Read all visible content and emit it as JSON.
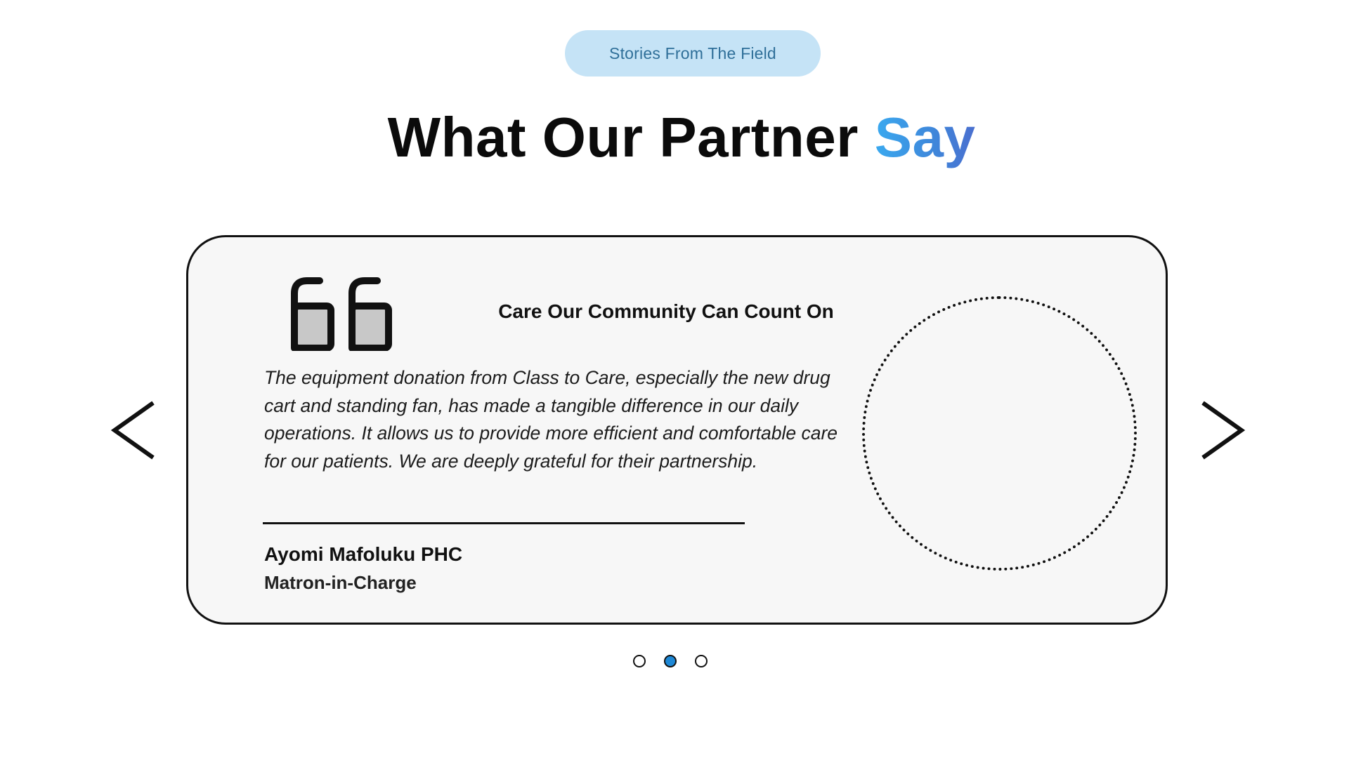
{
  "badge": {
    "label": "Stories From The Field",
    "background": "#c5e3f6",
    "text_color": "#2f6f99"
  },
  "heading": {
    "main": "What Our Partner ",
    "accent": "Say",
    "accent_colors": [
      "#3aa9ef",
      "#4a6fcf"
    ]
  },
  "testimonial": {
    "icon": "quote-icon",
    "title": "Care Our Community Can Count On",
    "quote": "The equipment donation from Class to Care, especially the new drug cart and standing fan, has made a tangible difference in our daily operations. It allows us to provide more efficient and comfortable care for our patients. We are deeply grateful for their partnership.",
    "author_name": "Ayomi Mafoluku PHC",
    "author_role": "Matron-in-Charge",
    "photo_placeholder": "dotted-circle"
  },
  "navigation": {
    "prev_icon": "chevron-left-icon",
    "next_icon": "chevron-right-icon"
  },
  "pagination": {
    "total": 3,
    "active_index": 1,
    "active_color": "#1e88d6"
  }
}
